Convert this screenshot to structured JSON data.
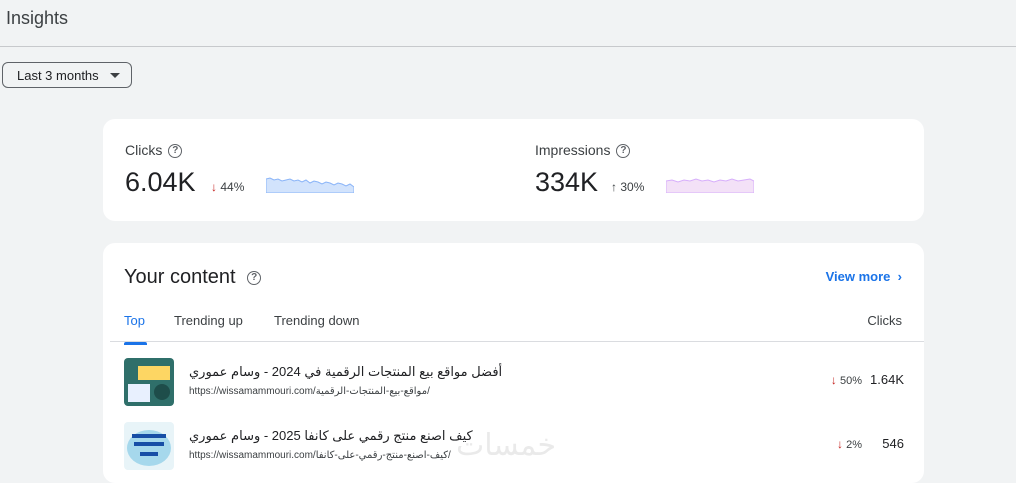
{
  "header": {
    "title": "Insights"
  },
  "date_range": {
    "label": "Last 3 months"
  },
  "metrics": {
    "clicks": {
      "label": "Clicks",
      "value": "6.04K",
      "delta": "44%",
      "direction": "down",
      "spark_color": "#aecbfa"
    },
    "impressions": {
      "label": "Impressions",
      "value": "334K",
      "delta": "30%",
      "direction": "up",
      "spark_color": "#e8c7f2"
    }
  },
  "content": {
    "title": "Your content",
    "view_more": "View more",
    "tabs": [
      "Top",
      "Trending up",
      "Trending down"
    ],
    "column_header": "Clicks",
    "rows": [
      {
        "title": "أفضل مواقع بيع المنتجات الرقمية في 2024 - وسام عموري",
        "url": "https://wissamammouri.com/مواقع-بيع-المنتجات-الرقمية/",
        "delta": "50%",
        "direction": "down",
        "clicks": "1.64K"
      },
      {
        "title": "كيف اصنع منتج رقمي على كانفا 2025 - وسام عموري",
        "url": "https://wissamammouri.com/كيف-اصنع-منتج-رقمي-على-كانفا/",
        "delta": "2%",
        "direction": "down",
        "clicks": "546"
      }
    ]
  },
  "colors": {
    "accent": "#1a73e8",
    "down": "#c5221f"
  },
  "watermark": "خمسات"
}
